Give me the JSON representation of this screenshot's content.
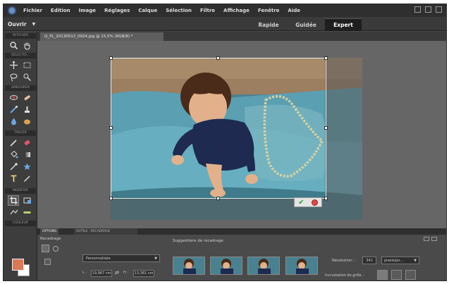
{
  "menubar": {
    "items": [
      "Fichier",
      "Edition",
      "Image",
      "Réglages",
      "Calque",
      "Sélection",
      "Filtre",
      "Affichage",
      "Fenêtre",
      "Aide"
    ]
  },
  "modebar": {
    "open_label": "Ouvrir",
    "tabs": {
      "rapide": "Rapide",
      "guidee": "Guidée",
      "expert": "Expert"
    }
  },
  "toolbar": {
    "sections": [
      "AFFICHER",
      "SÉLECTIO...",
      "AMÉLIORER",
      "TRACER",
      "MODIFIER",
      "COULEUR"
    ]
  },
  "document": {
    "tab_label": "Q_PL_20130512_0924.jpg @ 15,5% (RGB/8) *"
  },
  "panel": {
    "tab_options": "OPTIONS",
    "tab_other": "OUTILS  ·  RECADRAGE",
    "options_title": "Recadrage",
    "aspect_value": "Personnalisée",
    "width_label": "L :",
    "width_value": "19,967 cm",
    "height_label": "H :",
    "height_value": "13,381 cm",
    "suggestions_label": "Suggestions de recadrage",
    "resolution_label": "Résolution :",
    "resolution_value": "341",
    "units_value": "pixels/po...",
    "grid_label": "Incrustation de grille :"
  },
  "colors": {
    "foreground": "#d97a55",
    "background": "#ffffff",
    "accent_active_tab": "#1e1e1e"
  }
}
